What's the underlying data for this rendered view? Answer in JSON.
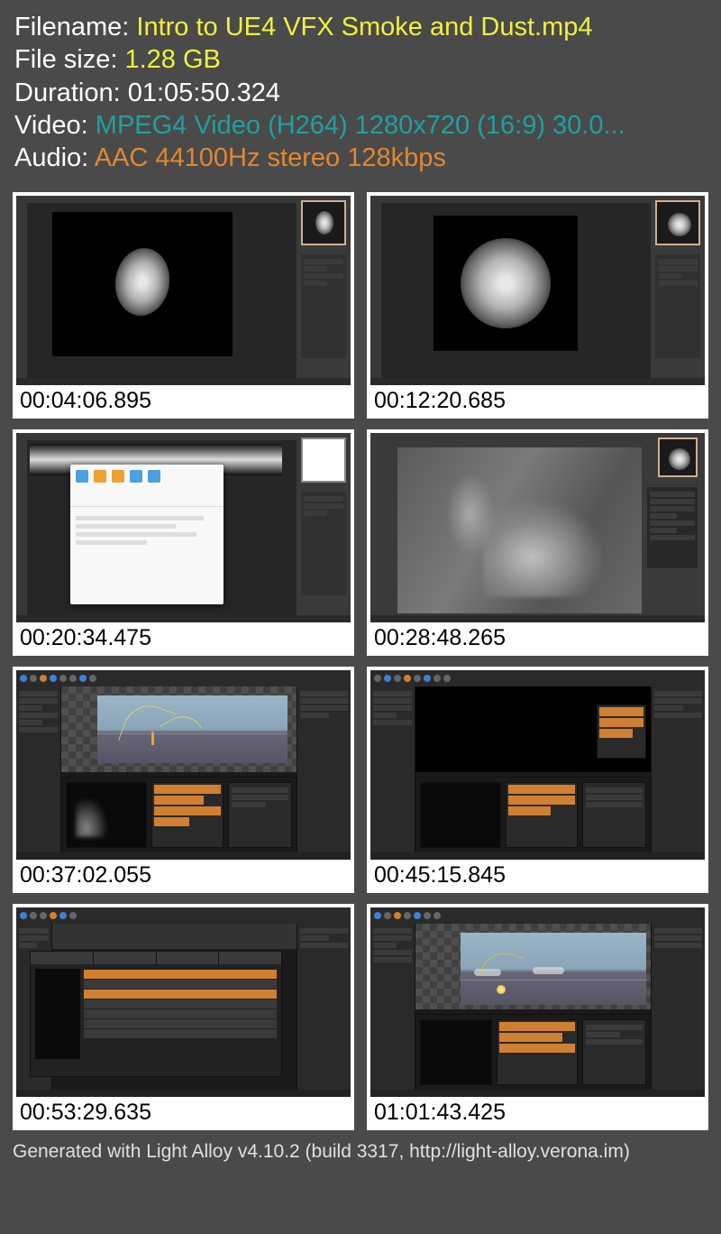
{
  "info": {
    "filename_label": "Filename:",
    "filename_value": "Intro to UE4 VFX Smoke and Dust.mp4",
    "filesize_label": "File size:",
    "filesize_value": "1.28 GB",
    "duration_label": "Duration:",
    "duration_value": "01:05:50.324",
    "video_label": "Video:",
    "video_value": "MPEG4 Video (H264) 1280x720 (16:9) 30.0...",
    "audio_label": "Audio:",
    "audio_value": "AAC 44100Hz stereo 128kbps"
  },
  "thumbnails": [
    {
      "timestamp": "00:04:06.895"
    },
    {
      "timestamp": "00:12:20.685"
    },
    {
      "timestamp": "00:20:34.475"
    },
    {
      "timestamp": "00:28:48.265"
    },
    {
      "timestamp": "00:37:02.055"
    },
    {
      "timestamp": "00:45:15.845"
    },
    {
      "timestamp": "00:53:29.635"
    },
    {
      "timestamp": "01:01:43.425"
    }
  ],
  "footer": "Generated with Light Alloy v4.10.2 (build 3317, http://light-alloy.verona.im)"
}
